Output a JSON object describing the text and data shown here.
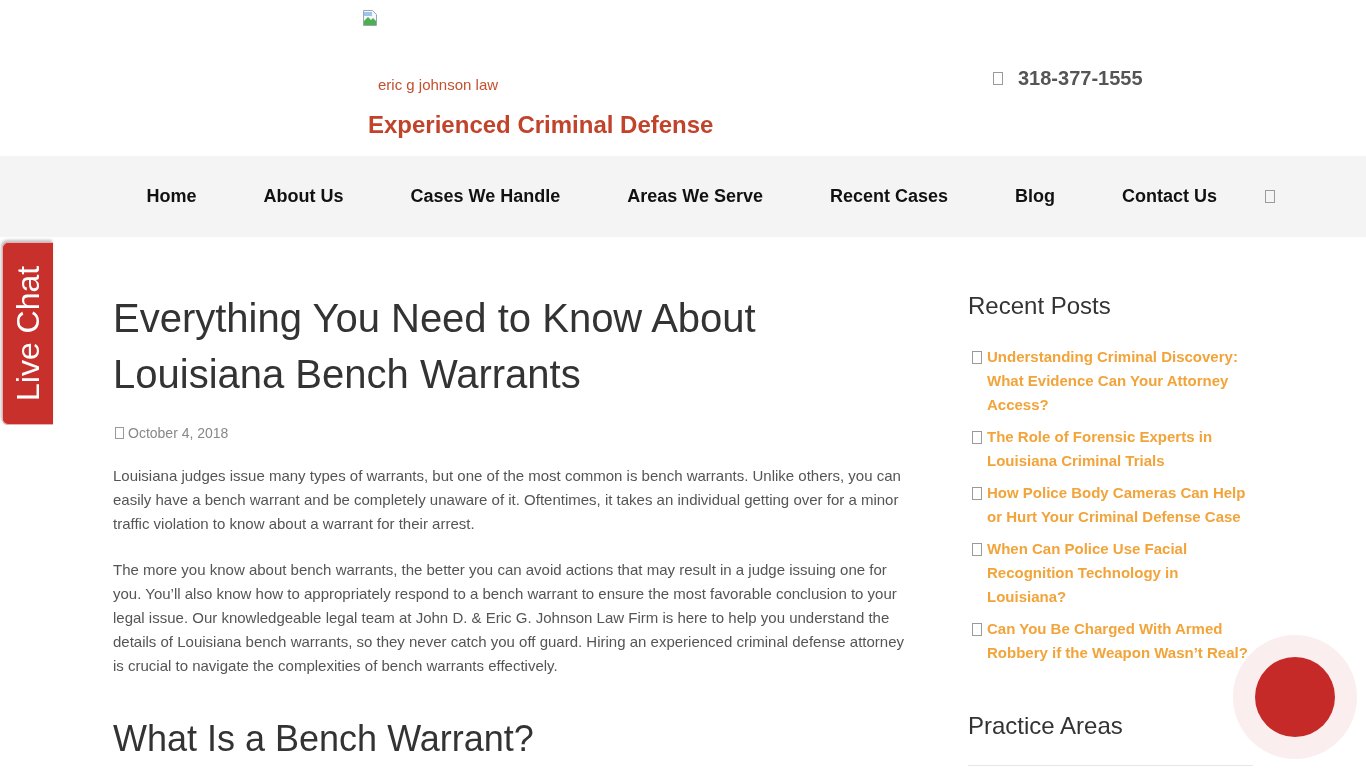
{
  "header": {
    "logo_text": "eric g johnson law",
    "tagline": "Experienced Criminal Defense",
    "phone": "318-377-1555"
  },
  "nav": {
    "items": [
      "Home",
      "About Us",
      "Cases We Handle",
      "Areas We Serve",
      "Recent Cases",
      "Blog",
      "Contact Us"
    ]
  },
  "live_chat": {
    "label": "Live Chat"
  },
  "article": {
    "title": "Everything You Need to Know About Louisiana Bench Warrants",
    "date": "October 4, 2018",
    "paragraphs": [
      "Louisiana judges issue many types of warrants, but one of the most common is bench warrants. Unlike others, you can easily have a bench warrant and be completely unaware of it. Oftentimes, it takes an individual getting over for a minor traffic violation to know about a warrant for their arrest.",
      "The more you know about bench warrants, the better you can avoid actions that may result in a judge issuing one for you. You’ll also know how to appropriately respond to a bench warrant to ensure the most favorable conclusion to your legal issue. Our knowledgeable legal team at John D. & Eric G. Johnson Law Firm is here to help you understand the details of Louisiana bench warrants, so they never catch you off guard. Hiring an experienced criminal defense attorney is crucial to navigate the complexities of bench warrants effectively."
    ],
    "subheading": "What Is a Bench Warrant?"
  },
  "sidebar": {
    "sections": [
      {
        "title": "Recent Posts",
        "links": [
          "Understanding Criminal Discovery: What Evidence Can Your Attorney Access?",
          "The Role of Forensic Experts in Louisiana Criminal Trials",
          "How Police Body Cameras Can Help or Hurt Your Criminal Defense Case",
          "When Can Police Use Facial Recognition Technology in Louisiana?",
          "Can You Be Charged With Armed Robbery if the Weapon Wasn’t Real?"
        ]
      },
      {
        "title": "Practice Areas"
      }
    ]
  }
}
